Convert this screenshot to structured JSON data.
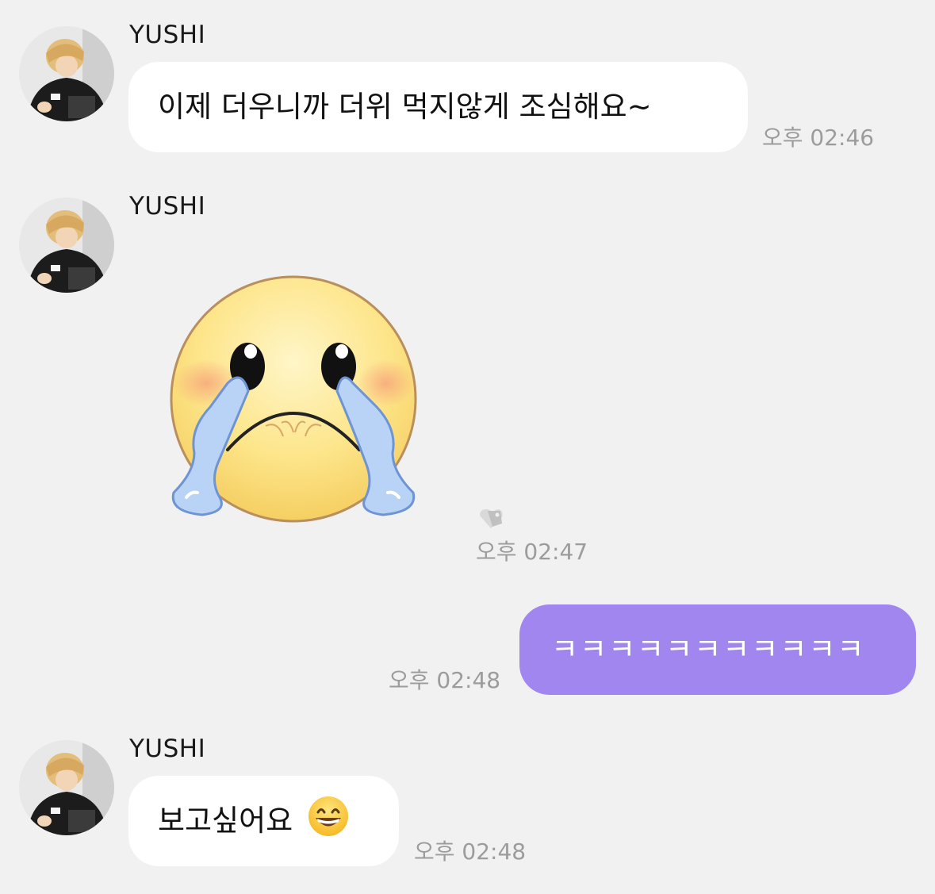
{
  "messages": [
    {
      "side": "incoming",
      "sender": "YUSHI",
      "text": "이제 더우니까 더위 먹지않게 조심해요~",
      "time": "오후 02:46",
      "avatar_icon": "profile-photo"
    },
    {
      "side": "incoming",
      "sender": "YUSHI",
      "sticker_icon": "crying-face-sticker",
      "sticker_badge_icon": "tag-heart-icon",
      "time": "오후 02:47",
      "avatar_icon": "profile-photo"
    },
    {
      "side": "outgoing",
      "text": "ㅋㅋㅋㅋㅋㅋㅋㅋㅋㅋㅋ",
      "time": "오후 02:48"
    },
    {
      "side": "incoming",
      "sender": "YUSHI",
      "text": "보고싶어요",
      "emoji_icon": "grinning-face-emoji",
      "time": "오후 02:48",
      "avatar_icon": "profile-photo"
    }
  ],
  "colors": {
    "background": "#f1f1f1",
    "incoming_bubble": "#ffffff",
    "outgoing_bubble": "#a286ef",
    "timestamp": "#9c9c9c"
  }
}
